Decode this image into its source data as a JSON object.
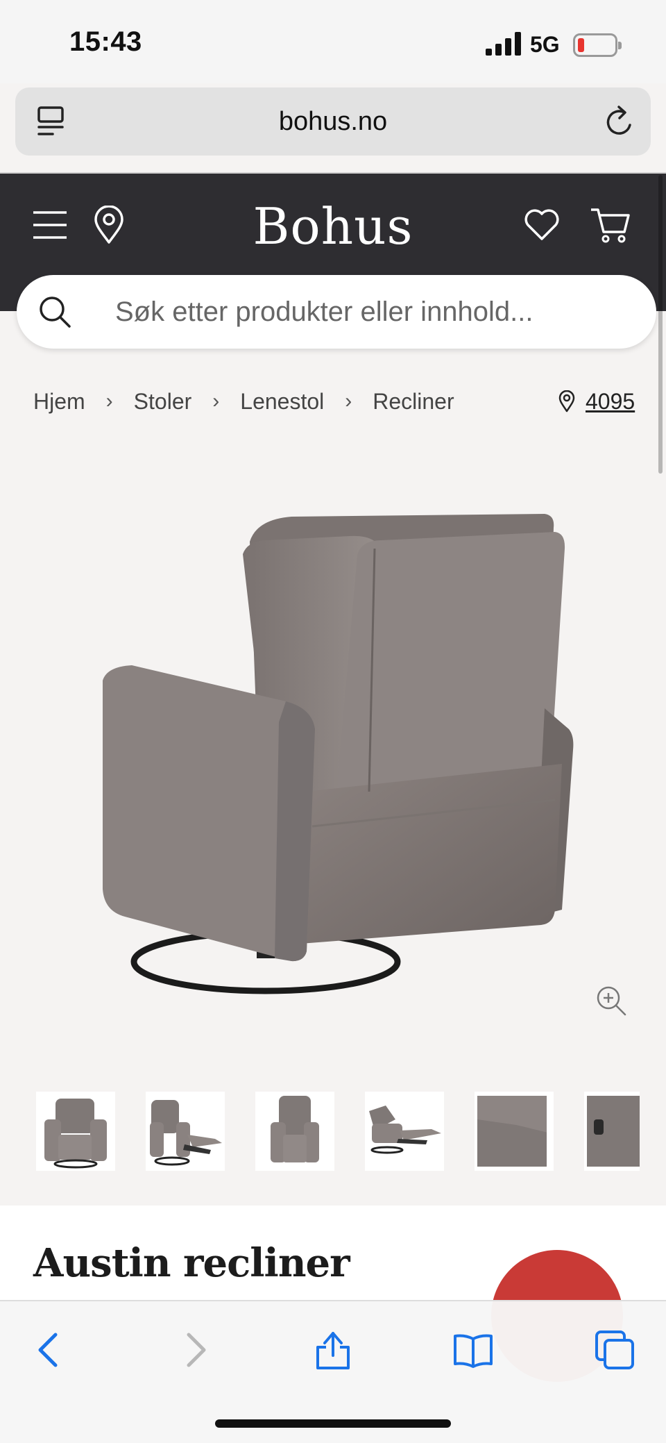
{
  "status_bar": {
    "time": "15:43",
    "network": "5G",
    "battery_color": "#e8352f"
  },
  "browser": {
    "url": "bohus.no"
  },
  "header": {
    "logo": "Bohus",
    "bg_color": "#2e2d31"
  },
  "search": {
    "placeholder": "Søk etter produkter eller innhold..."
  },
  "breadcrumb": {
    "items": [
      "Hjem",
      "Stoler",
      "Lenestol",
      "Recliner"
    ]
  },
  "store": {
    "number": "4095"
  },
  "product": {
    "title": "Austin recliner",
    "badge_color": "#c93a36"
  },
  "icons": [
    "reader-icon",
    "reload-icon",
    "menu-icon",
    "location-icon",
    "heart-icon",
    "cart-icon",
    "search-icon",
    "zoom-icon",
    "back-icon",
    "forward-icon",
    "share-icon",
    "bookmarks-icon",
    "tabs-icon"
  ]
}
